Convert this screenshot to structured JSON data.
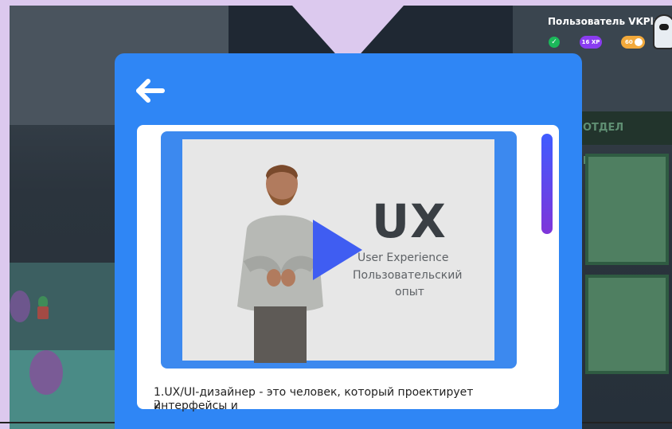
{
  "hud": {
    "user_name": "Пользователь VKPlay",
    "status_icon": "check-circle-icon",
    "xp": "16 XP",
    "coins": "60"
  },
  "scene": {
    "hr_sign": "ОТДЕЛ КАДРОВ"
  },
  "modal": {
    "back_icon": "arrow-left-icon",
    "video": {
      "title": "UX",
      "subtitle_en": "User Experience",
      "subtitle_ru_line1": "Пользовательский",
      "subtitle_ru_line2": "опыт"
    },
    "caption": "1.UX/UI-дизайнер - это человек, который проектирует интерфейсы и",
    "caption_cut": "2"
  },
  "colors": {
    "modal_blue": "#2f86f5",
    "video_frame_blue": "#3c89ef",
    "play_blue": "#3f5df2",
    "lilac": "#dcc9ee",
    "xp_purple": "#8a3cf0",
    "coin_orange": "#f2a93b"
  }
}
